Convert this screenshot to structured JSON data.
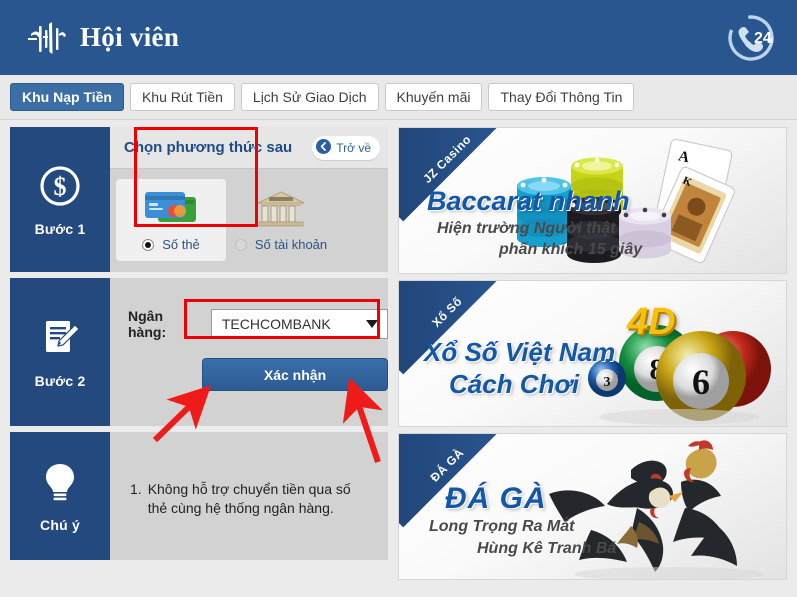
{
  "header": {
    "title": "Hội viên",
    "logo_icon": "brand-logo-icon",
    "support_icon": "phone-24h-icon",
    "support_text": "24н"
  },
  "tabs": [
    {
      "label": "Khu Nạp Tiền",
      "active": true
    },
    {
      "label": "Khu Rút Tiền",
      "active": false
    },
    {
      "label": "Lịch Sử Giao Dịch",
      "active": false
    },
    {
      "label": "Khuyến mãi",
      "active": false
    },
    {
      "label": "Thay Đổi Thông Tin",
      "active": false
    }
  ],
  "step1": {
    "side_label": "Bước 1",
    "side_icon": "dollar-coin-icon",
    "title": "Chọn phương thức sau",
    "back_button": "Trở về",
    "back_icon": "chevron-left-circle-icon",
    "options": [
      {
        "label": "Số thẻ",
        "icon": "credit-card-icon",
        "selected": true
      },
      {
        "label": "Số tài khoản",
        "icon": "bank-building-icon",
        "selected": false
      }
    ]
  },
  "step2": {
    "side_label": "Bước 2",
    "side_icon": "document-pencil-icon",
    "bank_label": "Ngân hàng:",
    "bank_value": "TECHCOMBANK",
    "dropdown_icon": "chevron-down-icon",
    "confirm_label": "Xác nhận"
  },
  "note": {
    "side_label": "Chú ý",
    "side_icon": "lightbulb-icon",
    "items": [
      {
        "num": "1.",
        "text": "Không hỗ trợ chuyển tiền qua số thẻ cùng hệ thống ngân hàng."
      }
    ]
  },
  "banners": [
    {
      "ribbon": "JZ Casino",
      "title": "Baccarat nhanh",
      "sub1": "Hiện trường Người thật",
      "sub2": "phấn khích 15 giây",
      "art": "casino-chips-cards-icon"
    },
    {
      "ribbon": "Xổ Số",
      "title1": "Xổ Số Việt Nam",
      "title2": "Cách Chơi",
      "badge": "4D",
      "art": "lottery-balls-icon",
      "ball_numbers": [
        "3",
        "8",
        "6"
      ]
    },
    {
      "ribbon": "ĐÁ GÀ",
      "title": "ĐÁ GÀ",
      "sub1": "Long Trọng Ra Mắt",
      "sub2": "Hùng Kê Tranh Bá",
      "art": "fighting-roosters-icon"
    }
  ],
  "colors": {
    "header_blue": "#2a5690",
    "step_side_blue": "#23497f",
    "panel_gray": "#d2d2d2",
    "page_bg": "#ebebeb",
    "highlight_red": "#ef0000",
    "accent_blue": "#1257a8",
    "button_blue": "#2c5b93"
  },
  "annotations": {
    "arrow1": "red-arrow-to-confirm-button",
    "arrow2": "red-arrow-to-bank-dropdown"
  }
}
